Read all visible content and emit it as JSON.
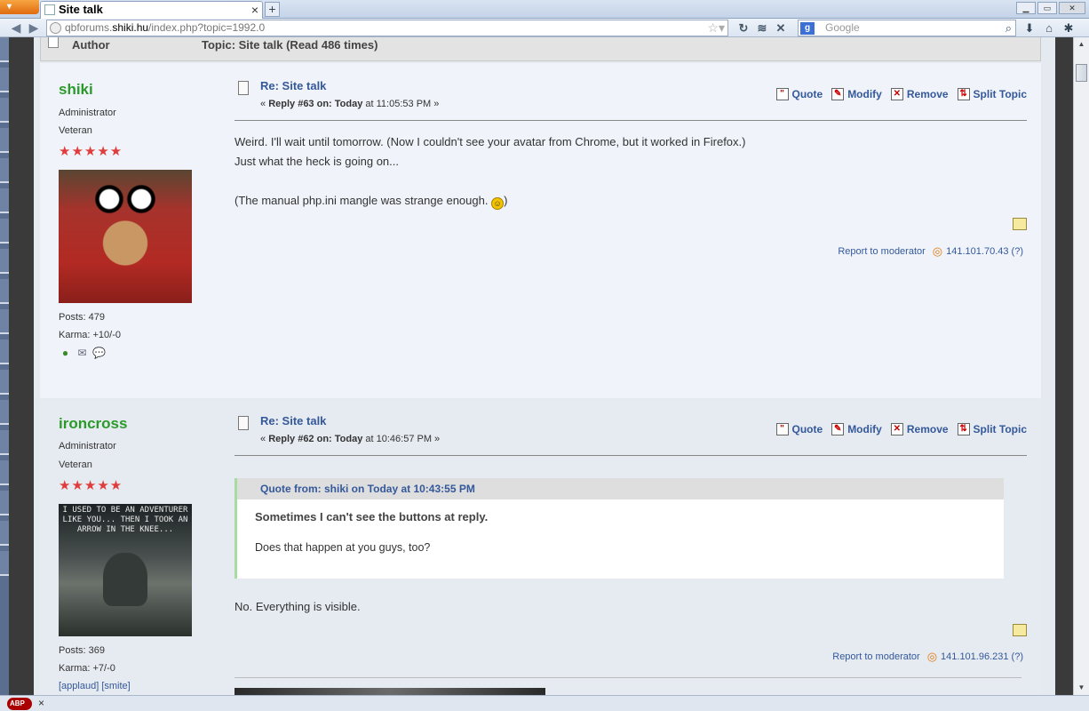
{
  "browser": {
    "menu_button_label": "",
    "tab_title": "Site talk",
    "tab_close": "×",
    "new_tab": "+",
    "url_prefix": "qbforums.",
    "url_domain": "shiki.hu",
    "url_path": "/index.php?topic=1992.0",
    "search_placeholder": "Google",
    "search_engine_letter": "g"
  },
  "header": {
    "author_label": "Author",
    "topic_label": "Topic: Site talk  (Read 486 times)"
  },
  "posts": [
    {
      "username": "shiki",
      "role": "Administrator",
      "rank": "Veteran",
      "stars": "★★★★★",
      "posts_stat": "Posts: 479",
      "karma_stat": "Karma: +10/-0",
      "subject": "Re: Site talk",
      "reply_prefix": "« ",
      "reply_bold": "Reply #63 on: Today",
      "reply_time": " at 11:05:53 PM »",
      "actions": {
        "quote": "Quote",
        "modify": "Modify",
        "remove": "Remove",
        "split": "Split Topic"
      },
      "body_line1": "Weird. I'll wait until tomorrow. (Now I couldn't see your avatar from Chrome, but it worked in Firefox.)",
      "body_line2": "Just what the heck is going on...",
      "body_line3_pre": "(The manual php.ini mangle was strange enough. ",
      "body_line3_post": ")",
      "report": "Report to moderator",
      "ip": "141.101.70.43 (?)"
    },
    {
      "username": "ironcross",
      "role": "Administrator",
      "rank": "Veteran",
      "stars": "★★★★★",
      "avatar_caption": "I USED TO BE AN ADVENTURER LIKE YOU... THEN I TOOK AN ARROW IN THE KNEE...",
      "posts_stat": "Posts: 369",
      "karma_stat": "Karma: +7/-0",
      "karma_links": "[applaud] [smite]",
      "subject": "Re: Site talk",
      "reply_prefix": "« ",
      "reply_bold": "Reply #62 on: Today",
      "reply_time": " at 10:46:57 PM »",
      "actions": {
        "quote": "Quote",
        "modify": "Modify",
        "remove": "Remove",
        "split": "Split Topic"
      },
      "quote_header": "Quote from: shiki on Today at 10:43:55 PM",
      "quote_strong": "Sometimes I can't see the buttons at reply.",
      "quote_text": "Does that happen at you guys, too?",
      "body": "No. Everything is visible.",
      "report": "Report to moderator",
      "ip": "141.101.96.231 (?)"
    }
  ],
  "status": {
    "abp": "ABP",
    "close": "×"
  }
}
